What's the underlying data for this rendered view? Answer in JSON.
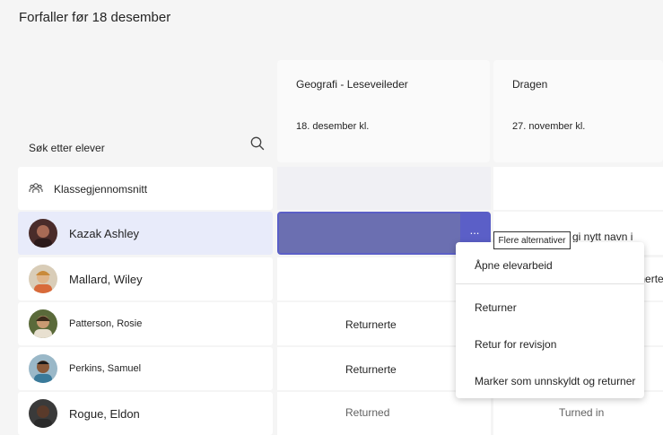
{
  "page": {
    "title": "Forfaller før 18 desember"
  },
  "search": {
    "label": "Søk etter elever"
  },
  "class_avg": {
    "label": "Klassegjennomsnitt"
  },
  "assignments": [
    {
      "title": "Geografi - Leseveileder",
      "date": "18. desember kl."
    },
    {
      "title": "Dragen",
      "date": "27. november kl."
    }
  ],
  "students": [
    {
      "name": "Kazak Ashley"
    },
    {
      "name": "Mallard, Wiley"
    },
    {
      "name": "Patterson, Rosie"
    },
    {
      "name": "Perkins, Samuel"
    },
    {
      "name": "Rogue, Eldon"
    }
  ],
  "cells": {
    "patterson_geo": "Returnerte",
    "perkins_geo": "Returnerte",
    "rogue_geo": "Returned",
    "kazak_dragen": "gi nytt navn i",
    "mallard_dragen": "Returnerte",
    "rogue_dragen": "Turned in"
  },
  "tooltip": {
    "text": "Flere alternativer"
  },
  "more_button": {
    "glyph": "..."
  },
  "menu": {
    "items": [
      "Åpne elevarbeid",
      "Returner",
      "Retur for revisjon",
      "Marker som unnskyldt og returner"
    ]
  },
  "colors": {
    "accent": "#5b5fc7",
    "selected_row": "#e8ebfa",
    "selected_cell": "#6b6fb1"
  }
}
